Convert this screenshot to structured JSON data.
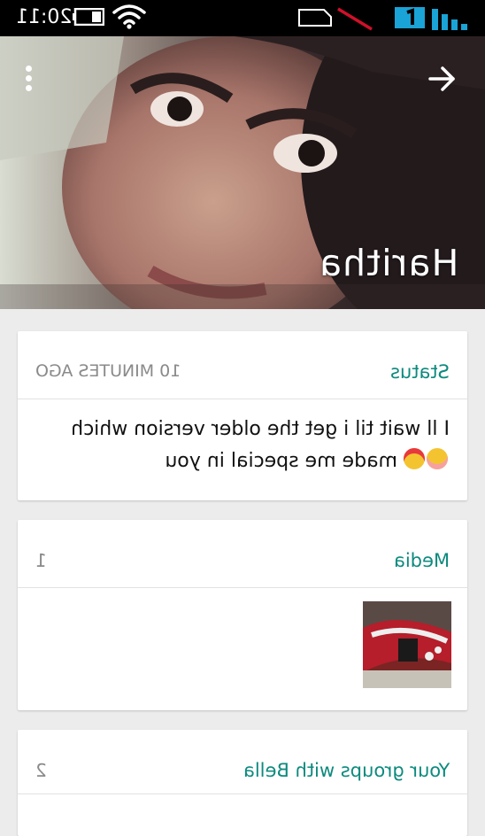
{
  "status_bar": {
    "time": "20:11",
    "icons": [
      "battery-icon",
      "wifi-icon",
      "sim-icon",
      "no-signal-icon",
      "data-1-icon",
      "signal-bars-icon"
    ],
    "colors": {
      "background": "#000000",
      "data_accent": "#1aa3d6"
    }
  },
  "header": {
    "contact_name": "Haritha",
    "menu_icon": "more-vertical-icon",
    "forward_icon": "arrow-right-icon"
  },
  "status_card": {
    "title": "Status",
    "time_ago": "10 MINUTES AGO",
    "text_line1": "I ll wait til i get the older version which",
    "text_line2": "made me special in you",
    "emojis": [
      "smiling-blushing-emoji",
      "heart-eyes-emoji"
    ]
  },
  "media_card": {
    "title": "Media",
    "count": "1"
  },
  "groups_card": {
    "title": "Your groups with Bella",
    "count": "2"
  },
  "colors": {
    "accent_teal": "#0d8a7e",
    "meta_gray": "#8a8a8a",
    "page_bg": "#ececec"
  }
}
